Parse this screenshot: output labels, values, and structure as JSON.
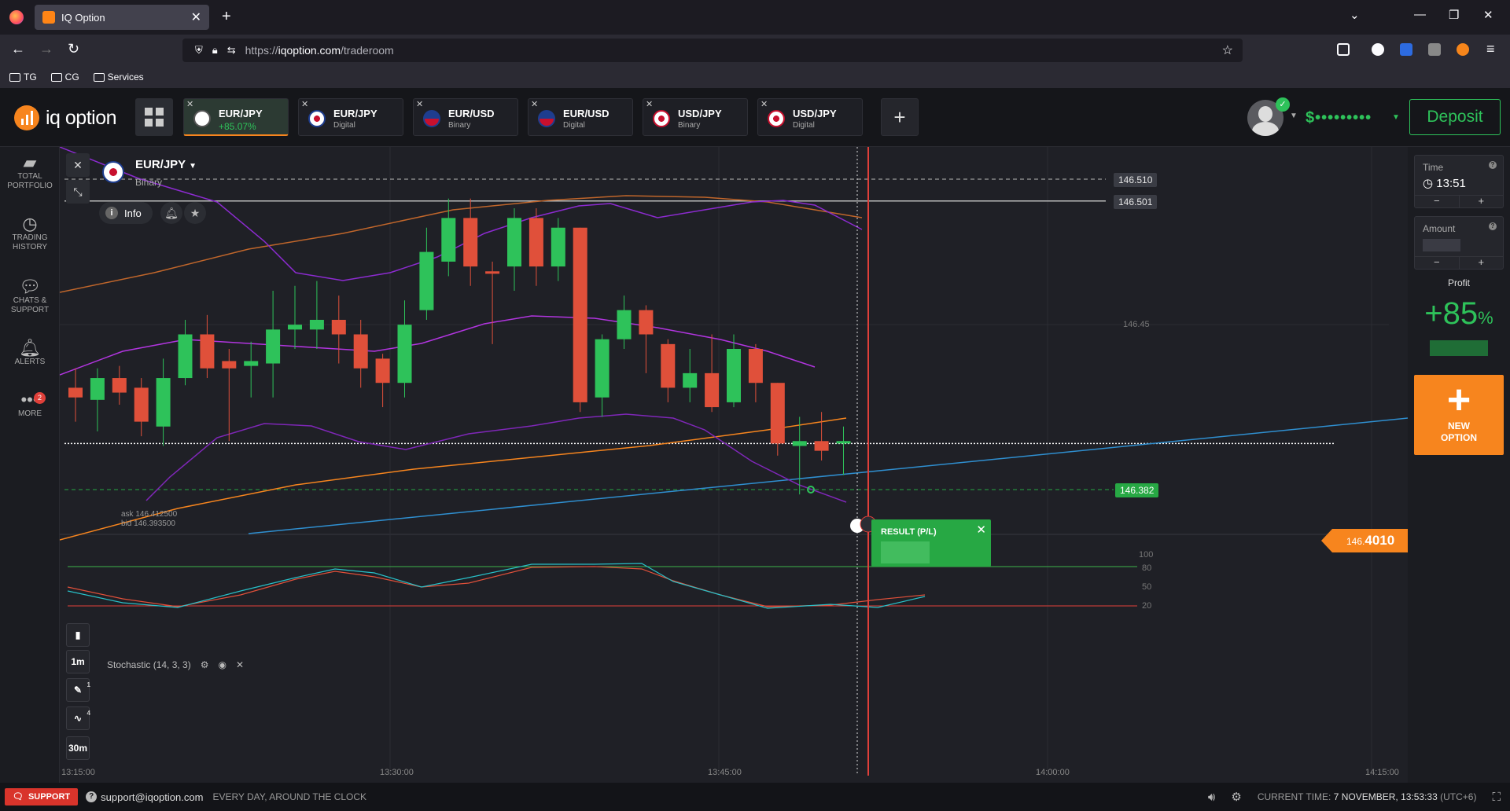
{
  "browser": {
    "tab_title": "IQ Option",
    "url_prefix": "https://",
    "url_host": "iqoption.com",
    "url_path": "/traderoom",
    "bookmarks": [
      {
        "label": "TG"
      },
      {
        "label": "CG"
      },
      {
        "label": "Services"
      }
    ]
  },
  "header": {
    "logo_text": "iq option",
    "asset_tabs": [
      {
        "name": "EUR/JPY",
        "sub": "+85.07%",
        "active": true
      },
      {
        "name": "EUR/JPY",
        "sub": "Digital",
        "active": false
      },
      {
        "name": "EUR/USD",
        "sub": "Binary",
        "active": false
      },
      {
        "name": "EUR/USD",
        "sub": "Digital",
        "active": false
      },
      {
        "name": "USD/JPY",
        "sub": "Binary",
        "active": false
      },
      {
        "name": "USD/JPY",
        "sub": "Digital",
        "active": false
      }
    ],
    "add_tab": "+",
    "balance": "$•••••••••",
    "deposit_label": "Deposit",
    "accent_green": "#2ec25a",
    "accent_orange": "#f7851e"
  },
  "sidebar": {
    "items": [
      {
        "label1": "TOTAL",
        "label2": "PORTFOLIO",
        "icon": "briefcase-icon"
      },
      {
        "label1": "TRADING",
        "label2": "HISTORY",
        "icon": "history-icon"
      },
      {
        "label1": "CHATS &",
        "label2": "SUPPORT",
        "icon": "chat-icon"
      },
      {
        "label1": "ALERTS",
        "label2": "",
        "icon": "bell-icon"
      },
      {
        "label1": "MORE",
        "label2": "",
        "icon": "more-icon",
        "badge": "2"
      }
    ]
  },
  "chart": {
    "asset_name": "EUR/JPY",
    "asset_type": "Binary",
    "info_label": "Info",
    "price_lines": [
      {
        "label": "146.510"
      },
      {
        "label": "146.501"
      },
      {
        "label": "146.382"
      }
    ],
    "y_mid_label": "146.45",
    "current_price_prefix": "146.",
    "current_price_main": "4010",
    "ask": "ask 146.412500",
    "bid": "bid 146.393500",
    "indicator": "Stochastic (14, 3, 3)",
    "stoch_levels": [
      "100",
      "80",
      "50",
      "20"
    ],
    "x_labels": [
      "13:30:00",
      "13:45:00",
      "14:00:00",
      "14:15:00"
    ],
    "x_label_left": "13:15:00",
    "timeframe": "1m",
    "candle_size": "30m",
    "tool_counts": [
      "1",
      "4"
    ],
    "result_title": "RESULT (P/L)",
    "candles": [
      {
        "o": 146.424,
        "c": 146.42,
        "h": 146.432,
        "l": 146.41
      },
      {
        "o": 146.419,
        "c": 146.428,
        "h": 146.432,
        "l": 146.406
      },
      {
        "o": 146.428,
        "c": 146.422,
        "h": 146.433,
        "l": 146.417
      },
      {
        "o": 146.424,
        "c": 146.41,
        "h": 146.428,
        "l": 146.404
      },
      {
        "o": 146.408,
        "c": 146.428,
        "h": 146.436,
        "l": 146.4
      },
      {
        "o": 146.428,
        "c": 146.446,
        "h": 146.452,
        "l": 146.425
      },
      {
        "o": 146.446,
        "c": 146.432,
        "h": 146.454,
        "l": 146.428
      },
      {
        "o": 146.435,
        "c": 146.432,
        "h": 146.44,
        "l": 146.402
      },
      {
        "o": 146.433,
        "c": 146.435,
        "h": 146.443,
        "l": 146.42
      },
      {
        "o": 146.434,
        "c": 146.448,
        "h": 146.464,
        "l": 146.42
      },
      {
        "o": 146.448,
        "c": 146.45,
        "h": 146.466,
        "l": 146.44
      },
      {
        "o": 146.448,
        "c": 146.452,
        "h": 146.468,
        "l": 146.44
      },
      {
        "o": 146.452,
        "c": 146.446,
        "h": 146.462,
        "l": 146.434
      },
      {
        "o": 146.446,
        "c": 146.432,
        "h": 146.452,
        "l": 146.424
      },
      {
        "o": 146.436,
        "c": 146.426,
        "h": 146.438,
        "l": 146.416
      },
      {
        "o": 146.426,
        "c": 146.45,
        "h": 146.46,
        "l": 146.42
      },
      {
        "o": 146.456,
        "c": 146.48,
        "h": 146.49,
        "l": 146.452
      },
      {
        "o": 146.476,
        "c": 146.494,
        "h": 146.502,
        "l": 146.47
      },
      {
        "o": 146.494,
        "c": 146.474,
        "h": 146.502,
        "l": 146.466
      },
      {
        "o": 146.472,
        "c": 146.471,
        "h": 146.476,
        "l": 146.442
      },
      {
        "o": 146.474,
        "c": 146.494,
        "h": 146.498,
        "l": 146.464
      },
      {
        "o": 146.494,
        "c": 146.474,
        "h": 146.498,
        "l": 146.466
      },
      {
        "o": 146.474,
        "c": 146.49,
        "h": 146.494,
        "l": 146.468
      },
      {
        "o": 146.49,
        "c": 146.418,
        "h": 146.49,
        "l": 146.414
      },
      {
        "o": 146.42,
        "c": 146.444,
        "h": 146.446,
        "l": 146.412
      },
      {
        "o": 146.444,
        "c": 146.456,
        "h": 146.462,
        "l": 146.44
      },
      {
        "o": 146.456,
        "c": 146.446,
        "h": 146.458,
        "l": 146.43
      },
      {
        "o": 146.442,
        "c": 146.424,
        "h": 146.444,
        "l": 146.418
      },
      {
        "o": 146.424,
        "c": 146.43,
        "h": 146.44,
        "l": 146.418
      },
      {
        "o": 146.43,
        "c": 146.416,
        "h": 146.446,
        "l": 146.414
      },
      {
        "o": 146.418,
        "c": 146.44,
        "h": 146.446,
        "l": 146.416
      },
      {
        "o": 146.44,
        "c": 146.426,
        "h": 146.442,
        "l": 146.418
      },
      {
        "o": 146.426,
        "c": 146.401,
        "h": 146.426,
        "l": 146.396
      },
      {
        "o": 146.4,
        "c": 146.402,
        "h": 146.412,
        "l": 146.38
      },
      {
        "o": 146.402,
        "c": 146.398,
        "h": 146.414,
        "l": 146.394
      },
      {
        "o": 146.401,
        "c": 146.402,
        "h": 146.408,
        "l": 146.388
      }
    ]
  },
  "right_panel": {
    "time_label": "Time",
    "time_value": "13:51",
    "amount_label": "Amount",
    "profit_label": "Profit",
    "profit_value": "+85",
    "profit_unit": "%",
    "new_option_line1": "NEW",
    "new_option_line2": "OPTION",
    "minus": "−",
    "plus": "+"
  },
  "footer": {
    "support_label": "SUPPORT",
    "email": "support@iqoption.com",
    "availability": "EVERY DAY, AROUND THE CLOCK",
    "current_time_label": "CURRENT TIME:",
    "current_time_value": "7 NOVEMBER, 13:53:33",
    "timezone": "(UTC+6)"
  }
}
